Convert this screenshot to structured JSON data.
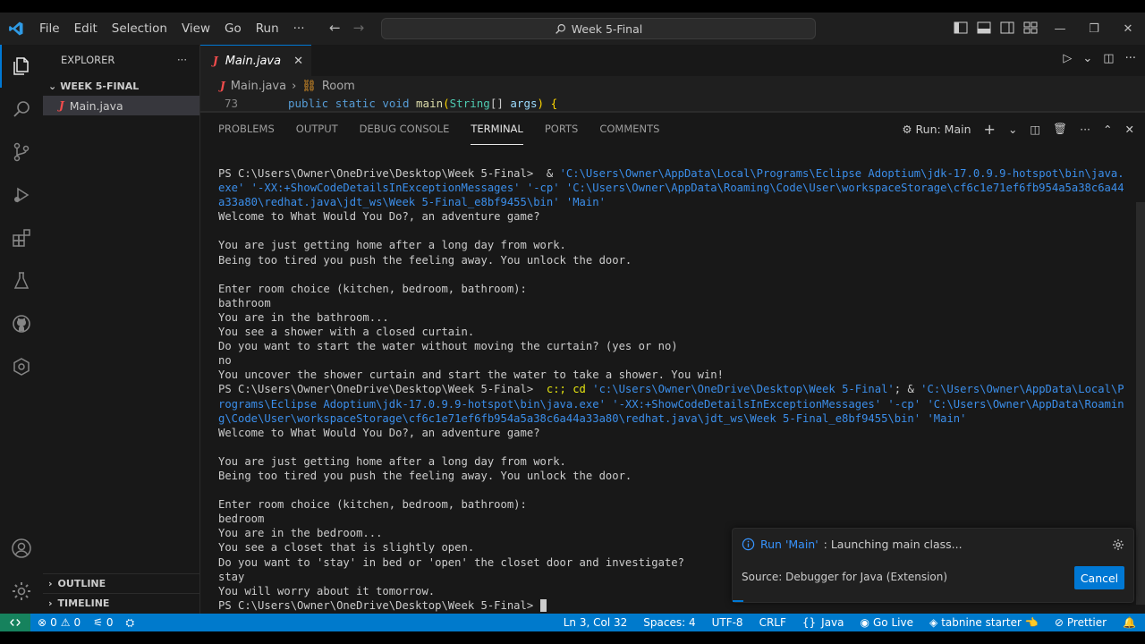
{
  "window": {
    "search_text": "Week 5-Final",
    "menu": [
      "File",
      "Edit",
      "Selection",
      "View",
      "Go",
      "Run",
      "···"
    ]
  },
  "sidebar": {
    "title": "EXPLORER",
    "more": "···",
    "folder": "WEEK 5-FINAL",
    "files": [
      "Main.java"
    ],
    "sections": [
      "OUTLINE",
      "TIMELINE"
    ]
  },
  "editor": {
    "tab_label": "Main.java",
    "breadcrumb": [
      "Main.java",
      "Room"
    ],
    "line_number": "73",
    "code_line": "public static void main(String[] args) {"
  },
  "panel": {
    "tabs": [
      "PROBLEMS",
      "OUTPUT",
      "DEBUG CONSOLE",
      "TERMINAL",
      "PORTS",
      "COMMENTS"
    ],
    "active_tab": "TERMINAL",
    "run_label": "Run: Main"
  },
  "terminal": {
    "lines": [
      {
        "t": "PS C:\\Users\\Owner\\OneDrive\\Desktop\\Week 5-Final>  & ",
        "c": "'C:\\Users\\Owner\\AppData\\Local\\Programs\\Eclipse Adoptium\\jdk-17.0.9.9-hotspot\\bin\\java."
      },
      {
        "t": "",
        "c": "exe' '-XX:+ShowCodeDetailsInExceptionMessages' '-cp' 'C:\\Users\\Owner\\AppData\\Roaming\\Code\\User\\workspaceStorage\\cf6c1e71ef6fb954a5a38c6a44"
      },
      {
        "t": "",
        "c": "a33a80\\redhat.java\\jdt_ws\\Week 5-Final_e8bf9455\\bin' 'Main'"
      },
      {
        "t": "Welcome to What Would You Do?, an adventure game?"
      },
      {
        "t": ""
      },
      {
        "t": "You are just getting home after a long day from work."
      },
      {
        "t": "Being too tired you push the feeling away. You unlock the door."
      },
      {
        "t": ""
      },
      {
        "t": "Enter room choice (kitchen, bedroom, bathroom):"
      },
      {
        "t": "bathroom"
      },
      {
        "t": "You are in the bathroom..."
      },
      {
        "t": "You see a shower with a closed curtain."
      },
      {
        "t": "Do you want to start the water without moving the curtain? (yes or no)"
      },
      {
        "t": "no"
      },
      {
        "t": "You uncover the shower curtain and start the water to take a shower. You win!"
      },
      {
        "t": "PS C:\\Users\\Owner\\OneDrive\\Desktop\\Week 5-Final>  ",
        "y": "c:; cd ",
        "c": "'c:\\Users\\Owner\\OneDrive\\Desktop\\Week 5-Final'",
        "t2": "; & ",
        "c2": "'C:\\Users\\Owner\\AppData\\Local\\P"
      },
      {
        "t": "",
        "c": "rograms\\Eclipse Adoptium\\jdk-17.0.9.9-hotspot\\bin\\java.exe' '-XX:+ShowCodeDetailsInExceptionMessages' '-cp' 'C:\\Users\\Owner\\AppData\\Roamin"
      },
      {
        "t": "",
        "c": "g\\Code\\User\\workspaceStorage\\cf6c1e71ef6fb954a5a38c6a44a33a80\\redhat.java\\jdt_ws\\Week 5-Final_e8bf9455\\bin' 'Main'"
      },
      {
        "t": "Welcome to What Would You Do?, an adventure game?"
      },
      {
        "t": ""
      },
      {
        "t": "You are just getting home after a long day from work."
      },
      {
        "t": "Being too tired you push the feeling away. You unlock the door."
      },
      {
        "t": ""
      },
      {
        "t": "Enter room choice (kitchen, bedroom, bathroom):"
      },
      {
        "t": "bedroom"
      },
      {
        "t": "You are in the bedroom..."
      },
      {
        "t": "You see a closet that is slightly open."
      },
      {
        "t": "Do you want to 'stay' in bed or 'open' the closet door and investigate?"
      },
      {
        "t": "stay"
      },
      {
        "t": "You will worry about it tomorrow."
      },
      {
        "t": "PS C:\\Users\\Owner\\OneDrive\\Desktop\\Week 5-Final> ",
        "cursor": true
      }
    ]
  },
  "toast": {
    "run": "Run 'Main'",
    "message": ": Launching main class...",
    "source": "Source: Debugger for Java (Extension)",
    "cancel": "Cancel"
  },
  "statusbar": {
    "errors": "0",
    "warnings": "0",
    "ports": "0",
    "position": "Ln 3, Col 32",
    "spaces": "Spaces: 4",
    "encoding": "UTF-8",
    "eol": "CRLF",
    "language": "Java",
    "golive": "Go Live",
    "tabnine": "tabnine starter",
    "prettier": "Prettier"
  },
  "colors": {
    "accent": "#0078d4",
    "statusbar": "#007acc",
    "terminal_path": "#3b8eea",
    "java_icon": "#f14c4c"
  }
}
